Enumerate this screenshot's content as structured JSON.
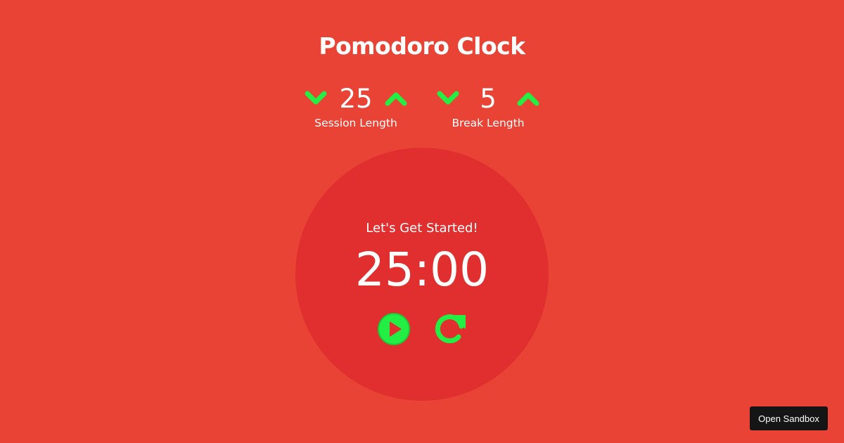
{
  "app": {
    "title": "Pomodoro Clock"
  },
  "session": {
    "value": "25",
    "label": "Session Length"
  },
  "break": {
    "value": "5",
    "label": "Break Length"
  },
  "timer": {
    "label": "Let's Get Started!",
    "display": "25:00"
  },
  "controls": {
    "play_icon": "play-circle-icon",
    "reset_icon": "redo-icon"
  },
  "footer": {
    "sandbox_label": "Open Sandbox"
  },
  "colors": {
    "background": "#e94335",
    "circle": "#e12e2f",
    "accent": "#22ee44",
    "text": "#ffffff",
    "sandbox_button": "#151515"
  }
}
